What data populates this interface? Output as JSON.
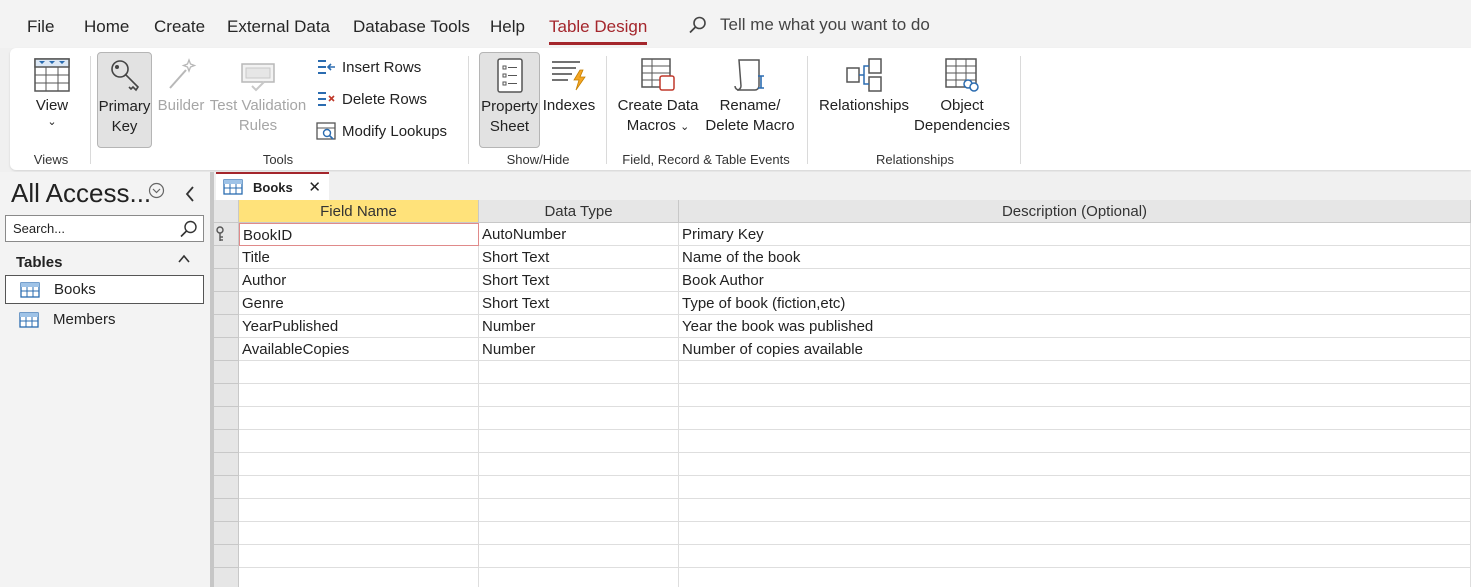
{
  "menu": {
    "file": "File",
    "home": "Home",
    "create": "Create",
    "external_data": "External Data",
    "database_tools": "Database Tools",
    "help": "Help",
    "table_design": "Table Design",
    "tell_me": "Tell me what you want to do"
  },
  "ribbon": {
    "view_label": "View",
    "views_group": "Views",
    "primary_key_l1": "Primary",
    "primary_key_l2": "Key",
    "builder": "Builder",
    "test_validation_l1": "Test Validation",
    "test_validation_l2": "Rules",
    "insert_rows": "Insert Rows",
    "delete_rows": "Delete Rows",
    "modify_lookups": "Modify Lookups",
    "tools_group": "Tools",
    "property_sheet_l1": "Property",
    "property_sheet_l2": "Sheet",
    "indexes": "Indexes",
    "showhide_group": "Show/Hide",
    "create_data_macros_l1": "Create Data",
    "create_data_macros_l2": "Macros",
    "rename_delete_macro_l1": "Rename/",
    "rename_delete_macro_l2": "Delete Macro",
    "events_group": "Field, Record & Table Events",
    "relationships": "Relationships",
    "object_dependencies_l1": "Object",
    "object_dependencies_l2": "Dependencies",
    "relationships_group": "Relationships"
  },
  "nav": {
    "title": "All Access...",
    "search_placeholder": "Search...",
    "section": "Tables",
    "items": [
      "Books",
      "Members"
    ]
  },
  "document": {
    "tab_label": "Books",
    "columns": [
      "Field Name",
      "Data Type",
      "Description (Optional)"
    ],
    "rows": [
      {
        "field": "BookID",
        "type": "AutoNumber",
        "desc": "Primary Key",
        "primary_key": true
      },
      {
        "field": "Title",
        "type": "Short Text",
        "desc": "Name of the book"
      },
      {
        "field": "Author",
        "type": "Short Text",
        "desc": "Book Author"
      },
      {
        "field": "Genre",
        "type": "Short Text",
        "desc": "Type of book (fiction,etc)"
      },
      {
        "field": "YearPublished",
        "type": "Number",
        "desc": "Year the book was published"
      },
      {
        "field": "AvailableCopies",
        "type": "Number",
        "desc": "Number of copies available"
      }
    ]
  },
  "colors": {
    "accent": "#a4262c",
    "selected_header": "#ffe27a"
  }
}
